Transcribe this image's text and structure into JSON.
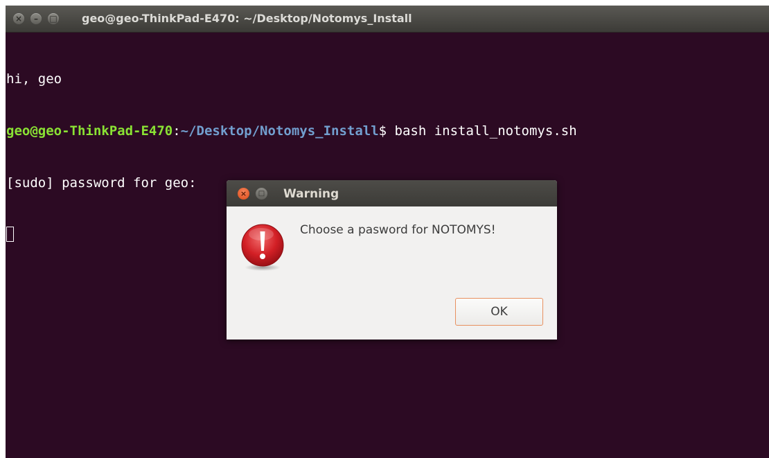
{
  "terminal": {
    "title": "geo@geo-ThinkPad-E470: ~/Desktop/Notomys_Install",
    "lines": {
      "greeting": "hi, geo",
      "prompt_user": "geo@geo-ThinkPad-E470",
      "prompt_colon": ":",
      "prompt_path": "~/Desktop/Notomys_Install",
      "prompt_command": "$ bash install_notomys.sh",
      "sudo_prompt": "[sudo] password for geo:"
    },
    "title_buttons": {
      "close": "×",
      "minimize": "–",
      "maximize": "□"
    },
    "colors": {
      "background": "#2c0a23",
      "prompt_user": "#8ae234",
      "prompt_path": "#729fcf"
    }
  },
  "dialog": {
    "title": "Warning",
    "message": "Choose a pasword for NOTOMYS!",
    "ok_label": "OK",
    "icon": "warning-exclamation-icon",
    "title_buttons": {
      "close": "×",
      "maximize": "□"
    }
  }
}
